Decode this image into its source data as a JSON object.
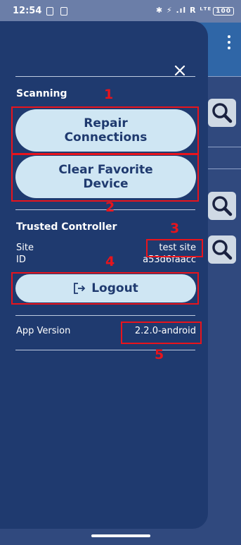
{
  "status_bar": {
    "time": "12:54",
    "right_text": "✱ ⚡ .ıl R ᴸᵀᴱ",
    "battery": "100"
  },
  "drawer": {
    "close_icon": "close-icon",
    "scanning": {
      "heading": "Scanning",
      "repair_label_line1": "Repair",
      "repair_label_line2": "Connections",
      "clear_label_line1": "Clear Favorite",
      "clear_label_line2": "Device"
    },
    "trusted": {
      "heading": "Trusted Controller",
      "site_label": "Site",
      "site_value": "test site",
      "id_label": "ID",
      "id_value": "a53d6faacc",
      "logout_label": "Logout",
      "logout_icon": "logout-icon"
    },
    "app_version": {
      "label": "App Version",
      "value": "2.2.0-android"
    }
  },
  "annotations": [
    "1",
    "2",
    "3",
    "4",
    "5"
  ],
  "colors": {
    "drawer_bg": "#1f3a6f",
    "pill_bg": "#cfe6f3",
    "pill_text": "#1f3a6f",
    "annotation": "#e8141c",
    "background": "#30497e"
  }
}
